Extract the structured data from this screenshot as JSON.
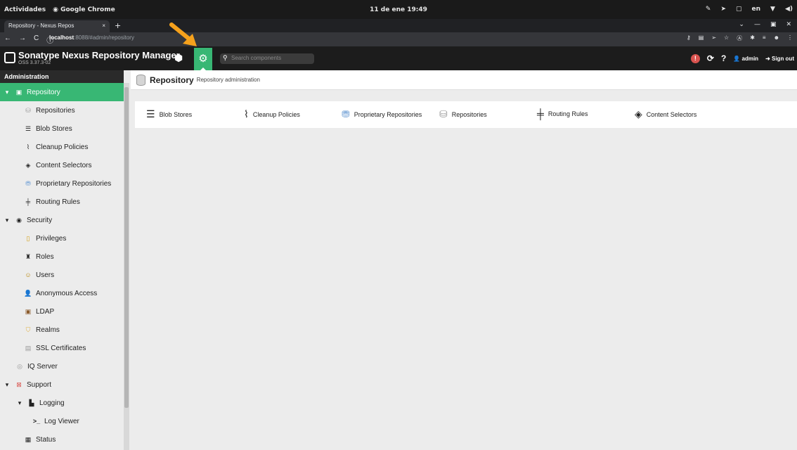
{
  "os_bar": {
    "activities": "Actividades",
    "app": "Google Chrome",
    "clock": "11 de ene 19:49",
    "lang": "en"
  },
  "browser": {
    "tab_title": "Repository - Nexus Repos",
    "tab_close": "×",
    "new_tab": "+",
    "url_host": "localhost",
    "url_rest": ":8088/#admin/repository",
    "window_controls": [
      "⌄",
      "—",
      "▣",
      "✕"
    ]
  },
  "nexus": {
    "title": "Sonatype Nexus Repository Manager",
    "version": "OSS 3.37.3-02",
    "search_placeholder": "Search components",
    "user": "admin",
    "sign_out": "Sign out",
    "accent": "#38b774"
  },
  "sidebar": {
    "header": "Administration",
    "items": [
      {
        "label": "Repository"
      },
      {
        "label": "Repositories"
      },
      {
        "label": "Blob Stores"
      },
      {
        "label": "Cleanup Policies"
      },
      {
        "label": "Content Selectors"
      },
      {
        "label": "Proprietary Repositories"
      },
      {
        "label": "Routing Rules"
      },
      {
        "label": "Security"
      },
      {
        "label": "Privileges"
      },
      {
        "label": "Roles"
      },
      {
        "label": "Users"
      },
      {
        "label": "Anonymous Access"
      },
      {
        "label": "LDAP"
      },
      {
        "label": "Realms"
      },
      {
        "label": "SSL Certificates"
      },
      {
        "label": "IQ Server"
      },
      {
        "label": "Support"
      },
      {
        "label": "Logging"
      },
      {
        "label": "Log Viewer"
      },
      {
        "label": "Status"
      }
    ]
  },
  "main": {
    "title": "Repository",
    "subtitle": "Repository administration",
    "cards": [
      {
        "label": "Blob Stores"
      },
      {
        "label": "Cleanup Policies"
      },
      {
        "label": "Proprietary Repositories"
      },
      {
        "label": "Repositories"
      },
      {
        "label": "Routing Rules"
      },
      {
        "label": "Content Selectors"
      }
    ]
  }
}
